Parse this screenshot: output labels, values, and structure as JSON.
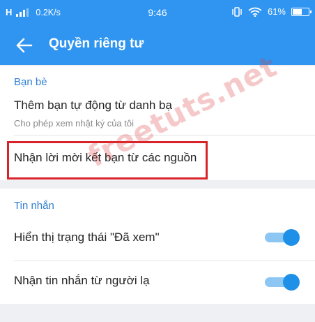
{
  "status_bar": {
    "network": "H",
    "speed": "0.2K/s",
    "time": "9:46",
    "battery": "61%",
    "battery_level": 0.61
  },
  "app_bar": {
    "title": "Quyền riêng tư",
    "back_icon": "arrow-left-icon"
  },
  "sections": [
    {
      "title": "Bạn bè",
      "rows": [
        {
          "title": "Thêm bạn tự động từ danh bạ",
          "subtitle": "Cho phép xem nhật ký của tôi"
        },
        {
          "title": "Nhận lời mời kết bạn từ các nguồn"
        }
      ]
    },
    {
      "title": "Tin nhắn",
      "rows": [
        {
          "title": "Hiển thị trạng thái \"Đã xem\"",
          "toggle": true
        },
        {
          "title": "Nhận tin nhắn từ người lạ",
          "toggle": true
        }
      ]
    }
  ],
  "watermark": "freetuts.net",
  "colors": {
    "primary": "#2f95f0",
    "section_title": "#2f7fd0",
    "toggle_on": "#1e90e8",
    "highlight": "#d9232b"
  }
}
